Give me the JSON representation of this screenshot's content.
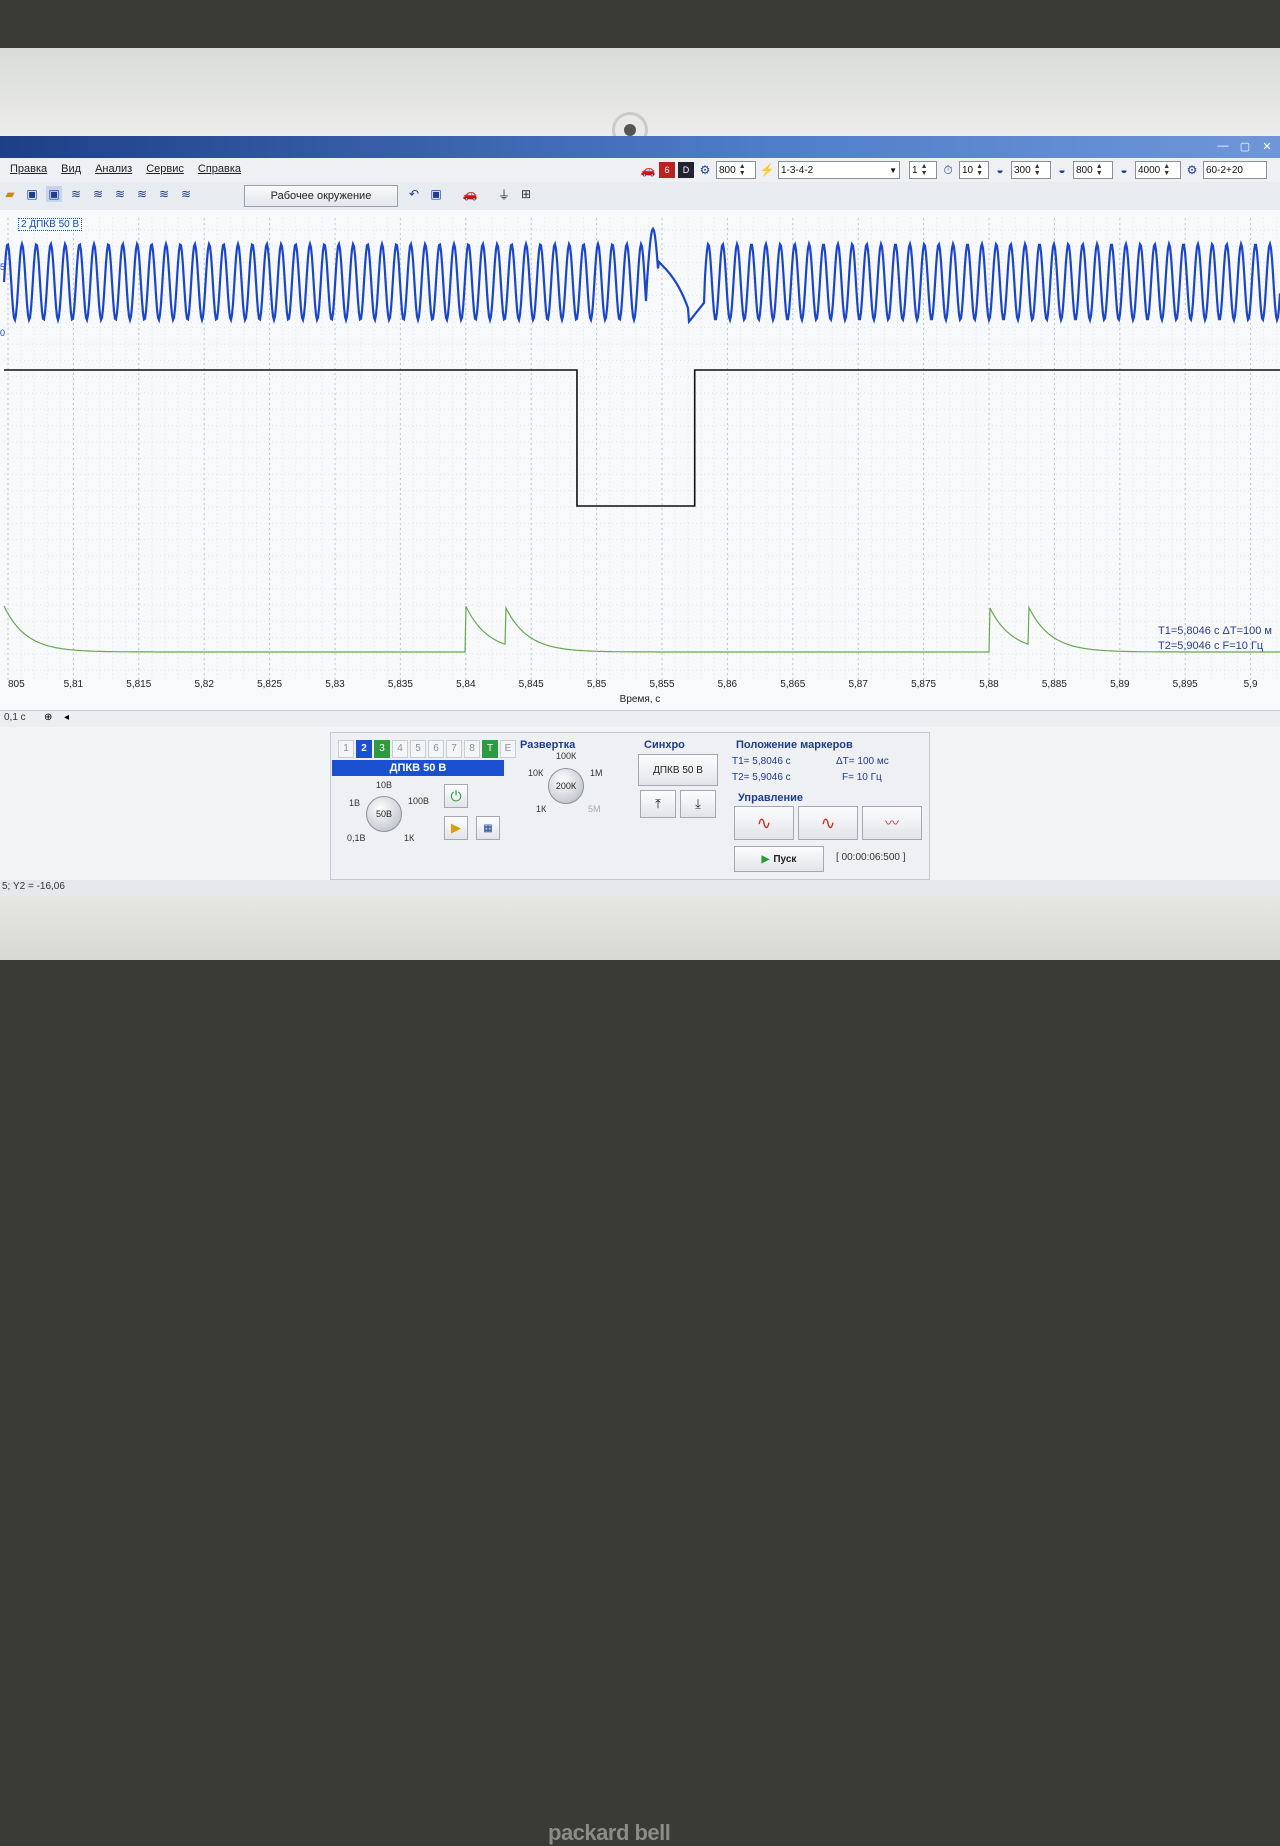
{
  "menu": [
    "Правка",
    "Вид",
    "Анализ",
    "Сервис",
    "Справка"
  ],
  "top_controls": {
    "rpm1": "800",
    "firing_order": "1-3-4-2",
    "cyl": "1",
    "v10": "10",
    "v300": "300",
    "v800": "800",
    "v4000": "4000",
    "preset": "60-2+20"
  },
  "toolbar": {
    "env_label": "Рабочее окружение"
  },
  "channel_label": "2 ДПКВ 50 В",
  "axis": {
    "ticks": [
      "805",
      "5,81",
      "5,815",
      "5,82",
      "5,825",
      "5,83",
      "5,835",
      "5,84",
      "5,845",
      "5,85",
      "5,855",
      "5,86",
      "5,865",
      "5,87",
      "5,875",
      "5,88",
      "5,885",
      "5,89",
      "5,895",
      "5,9"
    ],
    "xlabel": "Время, с",
    "left_marks": [
      "5",
      "0"
    ]
  },
  "marker_text": {
    "t1": "T1=5,8046 с ΔT=100 м",
    "t2": "T2=5,9046 с F=10 Гц"
  },
  "scroll": {
    "zoom": "0,1 с"
  },
  "channels_panel": {
    "tabs": [
      "1",
      "2",
      "3",
      "4",
      "5",
      "6",
      "7",
      "8",
      "T",
      "E"
    ],
    "active": "ДПКВ 50 В",
    "knob": "50В",
    "scale_labels": [
      "10В",
      "1В",
      "100В",
      "0,1В",
      "1К"
    ]
  },
  "sweep": {
    "title": "Развертка",
    "knob": "200К",
    "labels": [
      "100К",
      "10К",
      "1М",
      "1К",
      "5М"
    ]
  },
  "sync": {
    "title": "Синхро",
    "source": "ДПКВ 50 В"
  },
  "marker_pos": {
    "title": "Положение маркеров",
    "t1": "T1= 5,8046 с",
    "t2": "T2= 5,9046 с",
    "dt": "ΔT= 100 мс",
    "f": "F= 10 Гц"
  },
  "control": {
    "title": "Управление",
    "start": "Пуск",
    "timer": "[ 00:00:06:500 ]"
  },
  "status": "5; Y2 = -16,06",
  "brand": "packard bell",
  "colors": {
    "ch_blue": "#1c46c8",
    "ch_black": "#111111",
    "ch_green": "#6aa84f"
  },
  "waveforms": {
    "crank_teeth_per_period": 60,
    "missing_teeth": 2,
    "gap_start_s": 5.8485,
    "gap_end_s": 5.8575,
    "sync_pulse_low_s": [
      5.8485,
      5.8575
    ],
    "decay_spikes_s": [
      5.84,
      5.843,
      5.88,
      5.883
    ]
  }
}
